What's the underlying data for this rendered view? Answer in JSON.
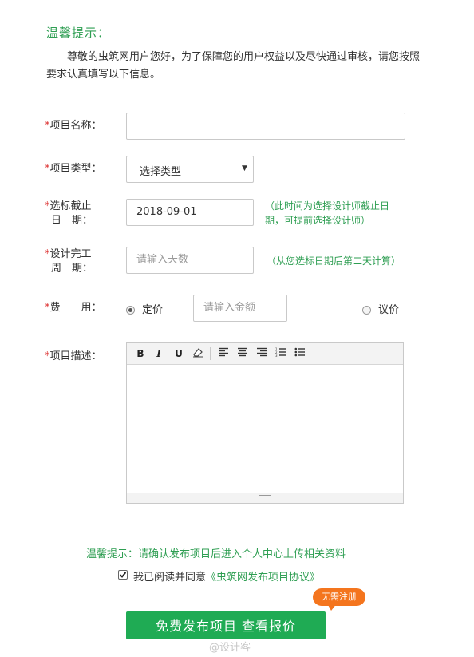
{
  "tip": {
    "title": "温馨提示：",
    "intro": "尊敬的虫筑网用户您好，为了保障您的用户权益以及尽快通过审核，请您按照要求认真填写以下信息。"
  },
  "form": {
    "required_mark": "*",
    "project_name": {
      "label": "项目名称：",
      "value": ""
    },
    "project_type": {
      "label": "项目类型：",
      "selected": "选择类型",
      "arrow": "▼"
    },
    "bid_deadline": {
      "label_line1": "选标截止",
      "label_line2": "日　期：",
      "value": "2018-09-01",
      "note": "（此时间为选择设计师截止日期，可提前选择设计师）"
    },
    "design_period": {
      "label_line1": "设计完工",
      "label_line2": "周　期：",
      "placeholder": "请输入天数",
      "note": "（从您选标日期后第二天计算）"
    },
    "fee": {
      "label": "费　　用：",
      "option_fixed": "定价",
      "amount_placeholder": "请输入金额",
      "option_negotiable": "议价",
      "selected": "fixed"
    },
    "description": {
      "label": "项目描述：",
      "toolbar": {
        "bold": "B",
        "italic": "I",
        "underline": "U"
      },
      "value": ""
    }
  },
  "bottom": {
    "tip": "温馨提示：请确认发布项目后进入个人中心上传相关资料",
    "agree_prefix": "我已阅读并同意",
    "agree_link": "《虫筑网发布项目协议》",
    "agree_checked": true,
    "submit_label": "免费发布项目  查看报价",
    "badge": "无需注册",
    "watermark": "@设计客"
  },
  "colors": {
    "accent_green": "#1fab54",
    "note_green": "#2e9e52",
    "required_red": "#dd3333",
    "badge_orange": "#f4751e"
  }
}
